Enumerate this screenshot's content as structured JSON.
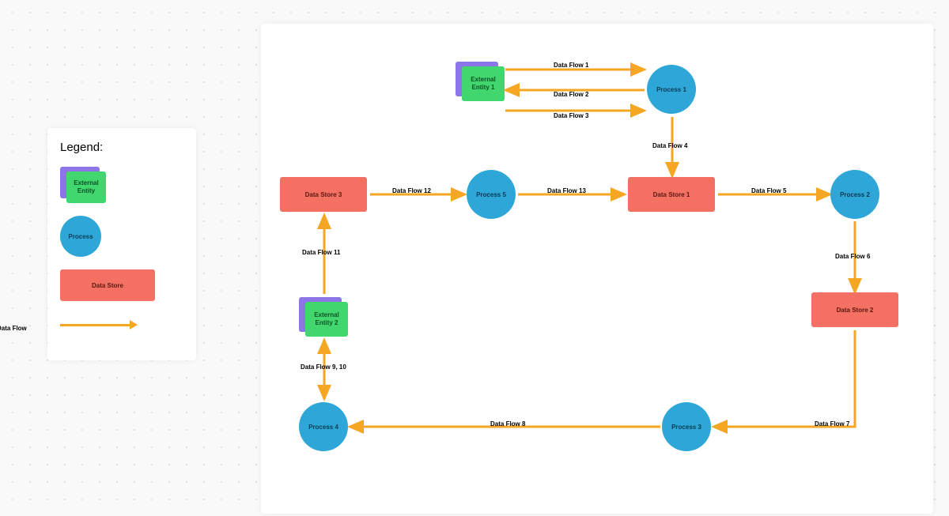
{
  "legend": {
    "title": "Legend:",
    "external_entity_label": "External Entity",
    "process_label": "Process",
    "data_store_label": "Data Store",
    "data_flow_label": "Data Flow"
  },
  "nodes": {
    "external_entity_1": "External Entity 1",
    "external_entity_2": "External Entity 2",
    "process_1": "Process 1",
    "process_2": "Process 2",
    "process_3": "Process 3",
    "process_4": "Process 4",
    "process_5": "Process 5",
    "data_store_1": "Data Store 1",
    "data_store_2": "Data Store 2",
    "data_store_3": "Data Store 3"
  },
  "flows": {
    "f1": "Data Flow 1",
    "f2": "Data Flow 2",
    "f3": "Data Flow 3",
    "f4": "Data Flow 4",
    "f5": "Data Flow 5",
    "f6": "Data Flow 6",
    "f7": "Data Flow 7",
    "f8": "Data Flow 8",
    "f9_10": "Data Flow 9, 10",
    "f11": "Data Flow 11",
    "f12": "Data Flow 12",
    "f13": "Data Flow 13"
  },
  "chart_data": {
    "type": "data-flow-diagram",
    "title": "",
    "nodes": [
      {
        "id": "ee1",
        "type": "external-entity",
        "label": "External Entity 1"
      },
      {
        "id": "ee2",
        "type": "external-entity",
        "label": "External Entity 2"
      },
      {
        "id": "p1",
        "type": "process",
        "label": "Process 1"
      },
      {
        "id": "p2",
        "type": "process",
        "label": "Process 2"
      },
      {
        "id": "p3",
        "type": "process",
        "label": "Process 3"
      },
      {
        "id": "p4",
        "type": "process",
        "label": "Process 4"
      },
      {
        "id": "p5",
        "type": "process",
        "label": "Process 5"
      },
      {
        "id": "ds1",
        "type": "data-store",
        "label": "Data Store 1"
      },
      {
        "id": "ds2",
        "type": "data-store",
        "label": "Data Store 2"
      },
      {
        "id": "ds3",
        "type": "data-store",
        "label": "Data Store 3"
      }
    ],
    "edges": [
      {
        "from": "ee1",
        "to": "p1",
        "label": "Data Flow 1"
      },
      {
        "from": "p1",
        "to": "ee1",
        "label": "Data Flow 2"
      },
      {
        "from": "ee1",
        "to": "p1",
        "label": "Data Flow 3"
      },
      {
        "from": "p1",
        "to": "ds1",
        "label": "Data Flow 4"
      },
      {
        "from": "ds1",
        "to": "p2",
        "label": "Data Flow 5"
      },
      {
        "from": "p2",
        "to": "ds2",
        "label": "Data Flow 6"
      },
      {
        "from": "ds2",
        "to": "p3",
        "label": "Data Flow 7"
      },
      {
        "from": "p3",
        "to": "p4",
        "label": "Data Flow 8"
      },
      {
        "from": "p4",
        "to": "ee2",
        "label": "Data Flow 9, 10",
        "bidirectional": true
      },
      {
        "from": "ee2",
        "to": "ds3",
        "label": "Data Flow 11"
      },
      {
        "from": "ds3",
        "to": "p5",
        "label": "Data Flow 12"
      },
      {
        "from": "p5",
        "to": "ds1",
        "label": "Data Flow 13"
      }
    ],
    "legend": {
      "external-entity": "External Entity",
      "process": "Process",
      "data-store": "Data Store",
      "edge": "Data Flow"
    },
    "colors": {
      "external-entity-back": "#8b75e8",
      "external-entity-front": "#42d66f",
      "process": "#2ea7d8",
      "data-store": "#f37062",
      "flow": "#f5a623"
    }
  }
}
